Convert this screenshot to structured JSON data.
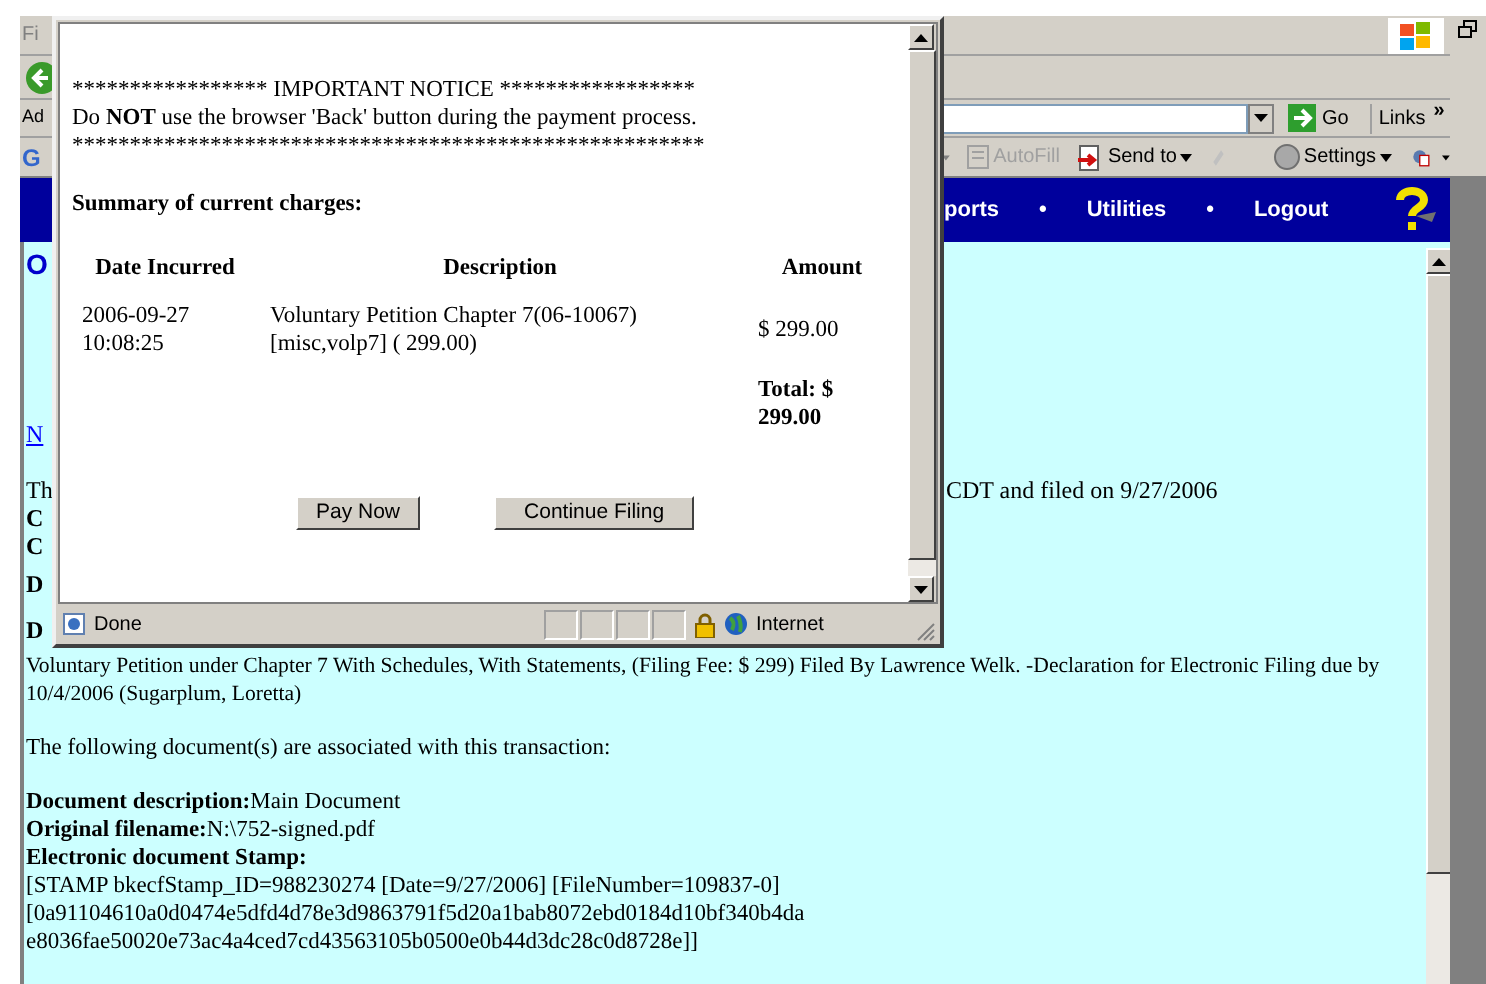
{
  "background_browser": {
    "menu_bar": {
      "label": "Fi"
    },
    "address_bar": {
      "label": "Ad",
      "go_button": "Go",
      "links": "Links",
      "links_chevron": "»"
    },
    "google_toolbar": {
      "label": "G",
      "items": [
        {
          "label": "AutoFill",
          "disabled": true
        },
        {
          "label": "Send to",
          "disabled": false
        }
      ],
      "settings": "Settings"
    },
    "nav_bar": {
      "items": [
        "ports",
        "•",
        "Utilities",
        "•",
        "Logout"
      ]
    },
    "content": {
      "left_fragments": [
        {
          "text": "O",
          "kind": "heading"
        },
        {
          "text": "N",
          "kind": "link"
        },
        {
          "text": "Th",
          "kind": "plain"
        },
        {
          "text": "C",
          "kind": "bold"
        },
        {
          "text": "C",
          "kind": "bold"
        },
        {
          "text": "D",
          "kind": "bold"
        },
        {
          "text": "D",
          "kind": "bold"
        }
      ],
      "filed_text": "CDT and filed on 9/27/2006",
      "docket_text": "Voluntary Petition under Chapter 7 With Schedules, With Statements, (Filing Fee: $ 299) Filed By Lawrence Welk. -Declaration for Electronic Filing due by 10/4/2006 (Sugarplum, Loretta)",
      "associated_text": "The following document(s) are associated with this transaction:",
      "fields": [
        {
          "label": "Document description:",
          "value": "Main Document"
        },
        {
          "label": "Original filename:",
          "value": "N:\\752-signed.pdf"
        },
        {
          "label": "Electronic document Stamp:"
        }
      ],
      "stamp_lines": [
        "[STAMP bkecfStamp_ID=988230274 [Date=9/27/2006] [FileNumber=109837-0]",
        "[0a91104610a0d0474e5dfd4d78e3d9863791f5d20a1bab8072ebd0184d10bf340b4da",
        "e8036fae50020e73ac4a4ced7cd43563105b0500e0b44d3dc28c0d8728e]]"
      ]
    }
  },
  "popup": {
    "notice_title": "***************** IMPORTANT NOTICE *****************",
    "notice_text": "Do **NOT** use the browser 'Back' button during the payment process.",
    "notice_rule": "*******************************************************",
    "summary_heading": "Summary of current charges:",
    "table": {
      "columns": [
        "Date Incurred",
        "Description",
        "Amount"
      ],
      "rows": [
        {
          "date": "2006-09-27 10:08:25",
          "description": "Voluntary Petition Chapter 7(06-10067) [misc,volp7] ( 299.00)",
          "amount": "$ 299.00"
        }
      ],
      "total": "Total: $ 299.00"
    },
    "buttons": [
      "Pay Now",
      "Continue Filing"
    ],
    "status_bar": {
      "status": "Done",
      "zone": "Internet"
    }
  }
}
